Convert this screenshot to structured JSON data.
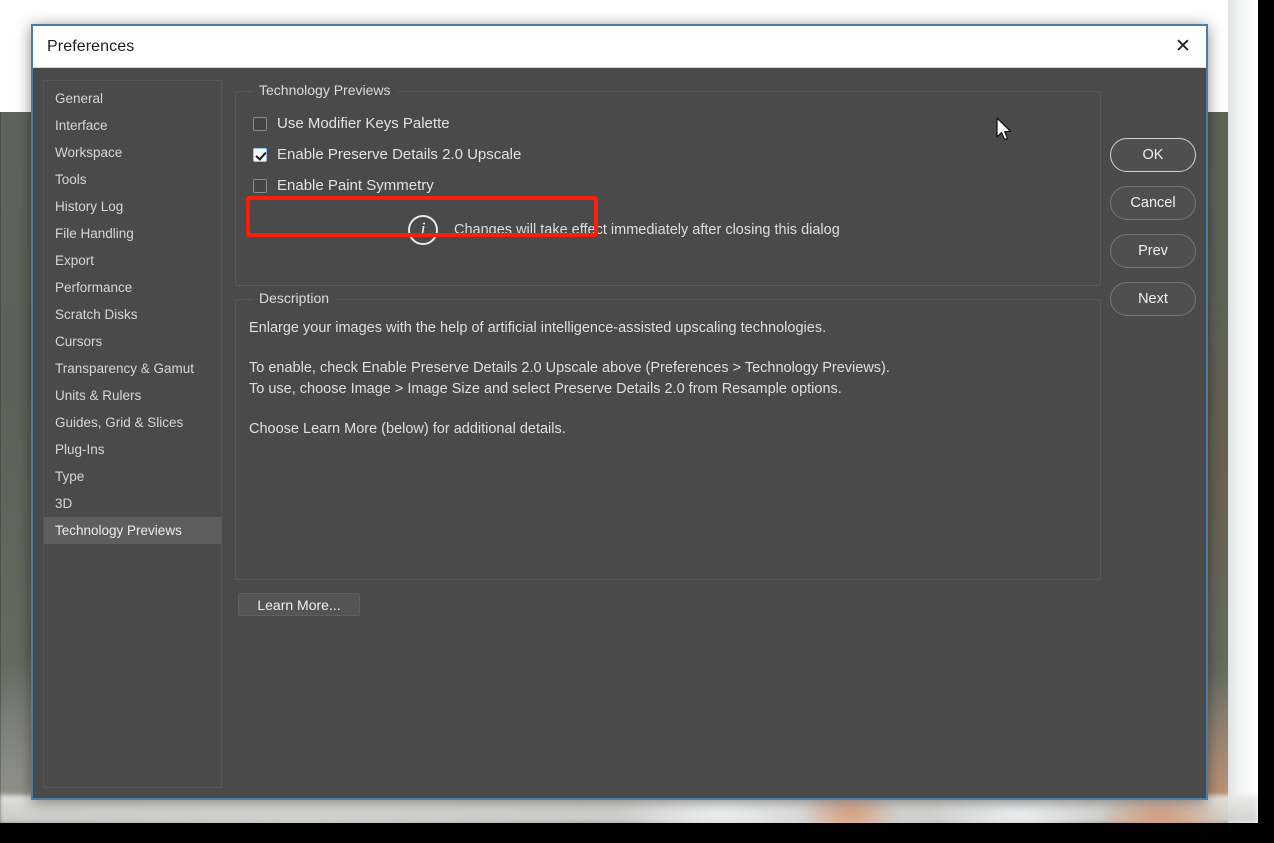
{
  "window": {
    "title": "Preferences",
    "close_icon": "close-icon",
    "close_glyph": "✕"
  },
  "sidebar": {
    "items": [
      {
        "label": "General",
        "selected": false
      },
      {
        "label": "Interface",
        "selected": false
      },
      {
        "label": "Workspace",
        "selected": false
      },
      {
        "label": "Tools",
        "selected": false
      },
      {
        "label": "History Log",
        "selected": false
      },
      {
        "label": "File Handling",
        "selected": false
      },
      {
        "label": "Export",
        "selected": false
      },
      {
        "label": "Performance",
        "selected": false
      },
      {
        "label": "Scratch Disks",
        "selected": false
      },
      {
        "label": "Cursors",
        "selected": false
      },
      {
        "label": "Transparency & Gamut",
        "selected": false
      },
      {
        "label": "Units & Rulers",
        "selected": false
      },
      {
        "label": "Guides, Grid & Slices",
        "selected": false
      },
      {
        "label": "Plug-Ins",
        "selected": false
      },
      {
        "label": "Type",
        "selected": false
      },
      {
        "label": "3D",
        "selected": false
      },
      {
        "label": "Technology Previews",
        "selected": true
      }
    ]
  },
  "technology_previews": {
    "legend": "Technology Previews",
    "checkboxes": [
      {
        "label": "Use Modifier Keys Palette",
        "checked": false
      },
      {
        "label": "Enable Preserve Details 2.0 Upscale",
        "checked": true
      },
      {
        "label": "Enable Paint Symmetry",
        "checked": false
      }
    ],
    "info_icon": "info-icon",
    "info_glyph": "i",
    "info_text": "Changes will take effect immediately after closing this dialog",
    "highlight_color": "#fc1e0c",
    "highlighted_item": "Enable Preserve Details 2.0 Upscale"
  },
  "description": {
    "legend": "Description",
    "paragraphs": [
      [
        "Enlarge your images with the help of artificial intelligence-assisted upscaling technologies."
      ],
      [
        "To enable, check Enable Preserve Details 2.0 Upscale above (Preferences > Technology Previews).",
        "To use, choose Image > Image Size and select Preserve Details 2.0 from Resample options."
      ],
      [
        "Choose Learn More (below) for additional details."
      ]
    ]
  },
  "learn_more_button": {
    "label": "Learn More..."
  },
  "action_buttons": [
    {
      "label": "OK",
      "primary": true
    },
    {
      "label": "Cancel",
      "primary": false
    },
    {
      "label": "Prev",
      "primary": false
    },
    {
      "label": "Next",
      "primary": false
    }
  ],
  "cursor": {
    "name": "mouse-pointer"
  },
  "colors": {
    "dialog_background": "#4a4a4a",
    "titlebar_background": "#ffffff",
    "dialog_border": "#4a7ea8",
    "selected_item_background": "#5e5e5e",
    "highlight_red": "#fc1e0c",
    "text": "#e2e2e2"
  }
}
